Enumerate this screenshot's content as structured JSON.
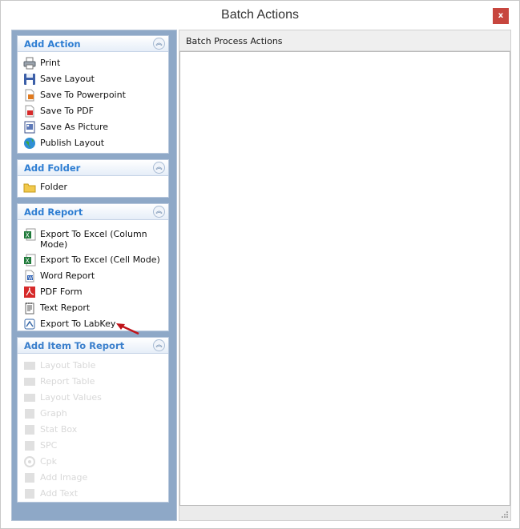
{
  "window": {
    "title": "Batch Actions",
    "close_label": "x"
  },
  "groups": [
    {
      "title": "Add Action",
      "items": [
        {
          "label": "Print",
          "icon": "printer-icon"
        },
        {
          "label": "Save Layout",
          "icon": "floppy-disk-icon"
        },
        {
          "label": "Save To Powerpoint",
          "icon": "powerpoint-file-icon"
        },
        {
          "label": "Save To PDF",
          "icon": "pdf-file-icon"
        },
        {
          "label": "Save As Picture",
          "icon": "picture-file-icon"
        },
        {
          "label": "Publish Layout",
          "icon": "globe-icon"
        }
      ]
    },
    {
      "title": "Add Folder",
      "items": [
        {
          "label": "Folder",
          "icon": "folder-icon"
        }
      ]
    },
    {
      "title": "Add Report",
      "items": [
        {
          "label": "Export To Excel (Column Mode)",
          "label_line1": "Export To Excel (Column",
          "label_line2": "Mode)",
          "icon": "excel-icon"
        },
        {
          "label": "Export To Excel (Cell Mode)",
          "icon": "excel-icon"
        },
        {
          "label": "Word Report",
          "icon": "word-icon"
        },
        {
          "label": "PDF Form",
          "icon": "pdf-form-icon"
        },
        {
          "label": "Text Report",
          "icon": "text-report-icon"
        },
        {
          "label": "Export To LabKey",
          "icon": "labkey-export-icon"
        }
      ]
    },
    {
      "title": "Add Item To Report",
      "items": [
        {
          "label": "Layout Table",
          "icon": "table-icon"
        },
        {
          "label": "Report Table",
          "icon": "table-icon"
        },
        {
          "label": "Layout Values",
          "icon": "table-icon"
        },
        {
          "label": "Graph",
          "icon": "graph-icon"
        },
        {
          "label": "Stat Box",
          "icon": "stat-box-icon"
        },
        {
          "label": "SPC",
          "icon": "spc-icon"
        },
        {
          "label": "Cpk",
          "icon": "gear-icon"
        },
        {
          "label": "Add Image",
          "icon": "image-icon"
        },
        {
          "label": "Add Text",
          "icon": "text-icon"
        }
      ]
    }
  ],
  "right": {
    "header": "Batch Process Actions"
  },
  "colors": {
    "pane_bg": "#8ea8c7",
    "group_title": "#2d7dd2",
    "arrow": "#c0141a",
    "close_bg": "#c7463e"
  }
}
